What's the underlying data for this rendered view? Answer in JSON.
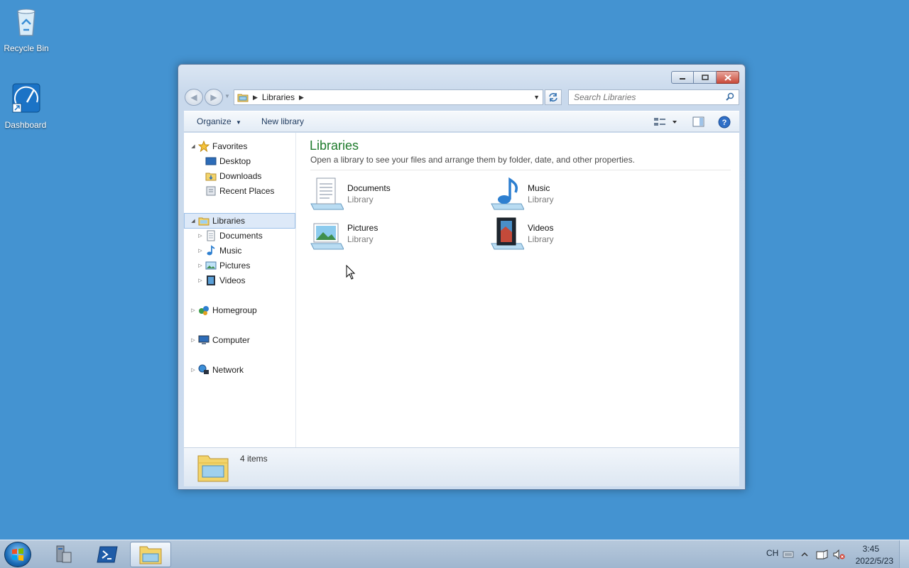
{
  "desktop": {
    "icons": [
      {
        "label": "Recycle Bin",
        "icon": "recycle-bin-icon"
      },
      {
        "label": "Dashboard",
        "icon": "dashboard-icon"
      }
    ]
  },
  "window": {
    "address": {
      "location": "Libraries",
      "icon": "libraries-folder-icon"
    },
    "search": {
      "placeholder": "Search Libraries"
    },
    "commands": {
      "organize": "Organize",
      "new_library": "New library"
    },
    "nav": {
      "favorites": {
        "label": "Favorites",
        "items": [
          "Desktop",
          "Downloads",
          "Recent Places"
        ]
      },
      "libraries": {
        "label": "Libraries",
        "items": [
          "Documents",
          "Music",
          "Pictures",
          "Videos"
        ]
      },
      "homegroup": "Homegroup",
      "computer": "Computer",
      "network": "Network"
    },
    "main": {
      "title": "Libraries",
      "subtitle": "Open a library to see your files and arrange them by folder, date, and other properties.",
      "libraries": [
        {
          "name": "Documents",
          "type": "Library",
          "icon": "documents-library-icon"
        },
        {
          "name": "Music",
          "type": "Library",
          "icon": "music-library-icon"
        },
        {
          "name": "Pictures",
          "type": "Library",
          "icon": "pictures-library-icon"
        },
        {
          "name": "Videos",
          "type": "Library",
          "icon": "videos-library-icon"
        }
      ]
    },
    "details": {
      "count": "4 items"
    }
  },
  "taskbar": {
    "language": "CH",
    "time": "3:45",
    "date": "2022/5/23"
  },
  "colors": {
    "desktop": "#4493d1",
    "title_green": "#1e7b2c",
    "selection": "#dde9f8"
  }
}
